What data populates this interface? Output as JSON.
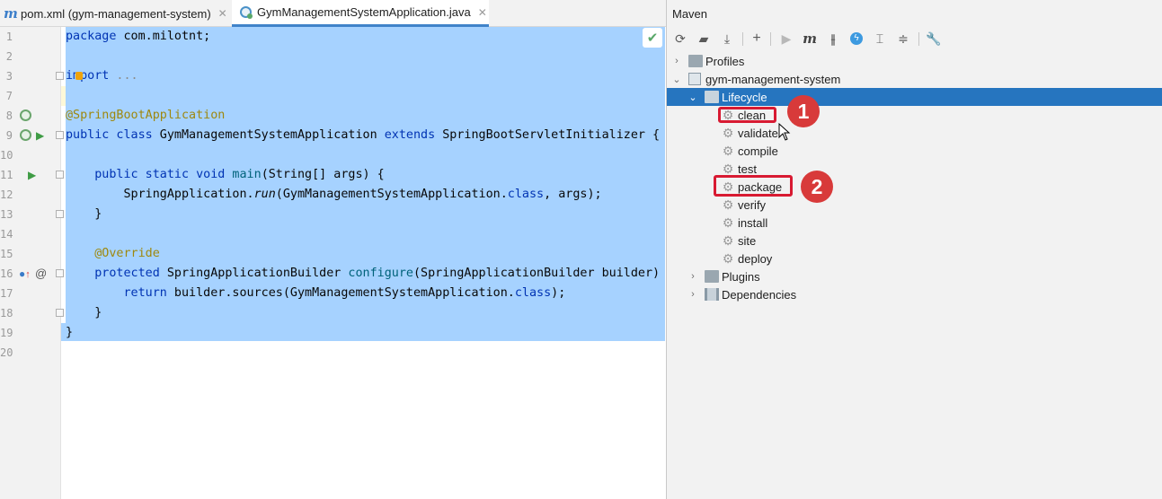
{
  "tabs": [
    {
      "label": "pom.xml (gym-management-system)",
      "icon": "maven-icon"
    },
    {
      "label": "GymManagementSystemApplication.java",
      "icon": "java-class-icon"
    }
  ],
  "editor": {
    "line_numbers": [
      "1",
      "2",
      "3",
      "7",
      "8",
      "9",
      "10",
      "11",
      "12",
      "13",
      "14",
      "15",
      "16",
      "17",
      "18",
      "19",
      "20"
    ],
    "lines": {
      "l1_kw": "package",
      "l1_rest": " com.milotnt;",
      "l3_kw": "import",
      "l3_rest": " ...",
      "l8_ann": "@SpringBootApplication",
      "l9_kw1": "public class",
      "l9_name": " GymManagementSystemApplication ",
      "l9_kw2": "extends",
      "l9_rest": " SpringBootServletInitializer {",
      "l11_kw": "    public static void",
      "l11_fn": " main",
      "l11_rest": "(String[] args) {",
      "l12_a": "        SpringApplication.",
      "l12_it": "run",
      "l12_b": "(GymManagementSystemApplication.",
      "l12_kw": "class",
      "l12_c": ", args);",
      "l13": "    }",
      "l15_ann": "    @Override",
      "l16_kw": "    protected",
      "l16_a": " SpringApplicationBuilder ",
      "l16_fn": "configure",
      "l16_b": "(SpringApplicationBuilder builder) {",
      "l17_kw": "        return",
      "l17_a": " builder.sources(GymManagementSystemApplication.",
      "l17_kw2": "class",
      "l17_b": ");",
      "l18": "    }",
      "l19": "}"
    }
  },
  "maven": {
    "title": "Maven",
    "toolbar": [
      "reload-icon",
      "add-folder-icon",
      "download-icon",
      "plus-icon",
      "run-icon",
      "maven-m-icon",
      "toggle-offline-icon",
      "skip-tests-icon",
      "show-dependencies-icon",
      "collapse-all-icon",
      "settings-wrench-icon"
    ],
    "tree": {
      "profiles": "Profiles",
      "project": "gym-management-system",
      "lifecycle": "Lifecycle",
      "phases": [
        "clean",
        "validate",
        "compile",
        "test",
        "package",
        "verify",
        "install",
        "site",
        "deploy"
      ],
      "plugins": "Plugins",
      "dependencies": "Dependencies"
    }
  },
  "annotations": {
    "step1": "1",
    "step2": "2",
    "color": "#d81a32"
  }
}
